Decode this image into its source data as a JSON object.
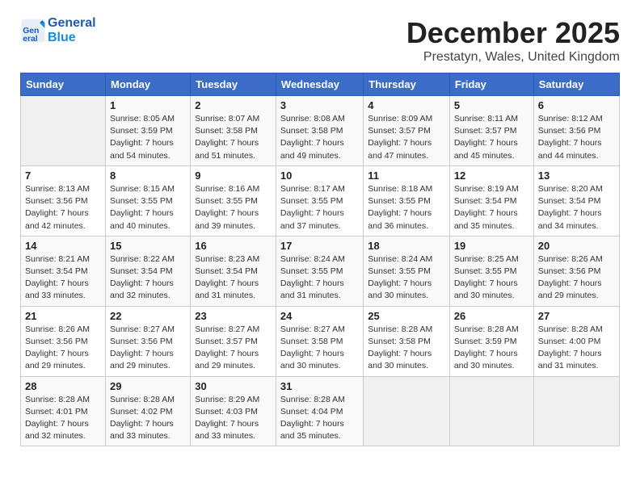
{
  "header": {
    "logo_line1": "General",
    "logo_line2": "Blue",
    "month": "December 2025",
    "location": "Prestatyn, Wales, United Kingdom"
  },
  "calendar": {
    "days_of_week": [
      "Sunday",
      "Monday",
      "Tuesday",
      "Wednesday",
      "Thursday",
      "Friday",
      "Saturday"
    ],
    "weeks": [
      [
        {
          "day": "",
          "info": ""
        },
        {
          "day": "1",
          "info": "Sunrise: 8:05 AM\nSunset: 3:59 PM\nDaylight: 7 hours\nand 54 minutes."
        },
        {
          "day": "2",
          "info": "Sunrise: 8:07 AM\nSunset: 3:58 PM\nDaylight: 7 hours\nand 51 minutes."
        },
        {
          "day": "3",
          "info": "Sunrise: 8:08 AM\nSunset: 3:58 PM\nDaylight: 7 hours\nand 49 minutes."
        },
        {
          "day": "4",
          "info": "Sunrise: 8:09 AM\nSunset: 3:57 PM\nDaylight: 7 hours\nand 47 minutes."
        },
        {
          "day": "5",
          "info": "Sunrise: 8:11 AM\nSunset: 3:57 PM\nDaylight: 7 hours\nand 45 minutes."
        },
        {
          "day": "6",
          "info": "Sunrise: 8:12 AM\nSunset: 3:56 PM\nDaylight: 7 hours\nand 44 minutes."
        }
      ],
      [
        {
          "day": "7",
          "info": "Sunrise: 8:13 AM\nSunset: 3:56 PM\nDaylight: 7 hours\nand 42 minutes."
        },
        {
          "day": "8",
          "info": "Sunrise: 8:15 AM\nSunset: 3:55 PM\nDaylight: 7 hours\nand 40 minutes."
        },
        {
          "day": "9",
          "info": "Sunrise: 8:16 AM\nSunset: 3:55 PM\nDaylight: 7 hours\nand 39 minutes."
        },
        {
          "day": "10",
          "info": "Sunrise: 8:17 AM\nSunset: 3:55 PM\nDaylight: 7 hours\nand 37 minutes."
        },
        {
          "day": "11",
          "info": "Sunrise: 8:18 AM\nSunset: 3:55 PM\nDaylight: 7 hours\nand 36 minutes."
        },
        {
          "day": "12",
          "info": "Sunrise: 8:19 AM\nSunset: 3:54 PM\nDaylight: 7 hours\nand 35 minutes."
        },
        {
          "day": "13",
          "info": "Sunrise: 8:20 AM\nSunset: 3:54 PM\nDaylight: 7 hours\nand 34 minutes."
        }
      ],
      [
        {
          "day": "14",
          "info": "Sunrise: 8:21 AM\nSunset: 3:54 PM\nDaylight: 7 hours\nand 33 minutes."
        },
        {
          "day": "15",
          "info": "Sunrise: 8:22 AM\nSunset: 3:54 PM\nDaylight: 7 hours\nand 32 minutes."
        },
        {
          "day": "16",
          "info": "Sunrise: 8:23 AM\nSunset: 3:54 PM\nDaylight: 7 hours\nand 31 minutes."
        },
        {
          "day": "17",
          "info": "Sunrise: 8:24 AM\nSunset: 3:55 PM\nDaylight: 7 hours\nand 31 minutes."
        },
        {
          "day": "18",
          "info": "Sunrise: 8:24 AM\nSunset: 3:55 PM\nDaylight: 7 hours\nand 30 minutes."
        },
        {
          "day": "19",
          "info": "Sunrise: 8:25 AM\nSunset: 3:55 PM\nDaylight: 7 hours\nand 30 minutes."
        },
        {
          "day": "20",
          "info": "Sunrise: 8:26 AM\nSunset: 3:56 PM\nDaylight: 7 hours\nand 29 minutes."
        }
      ],
      [
        {
          "day": "21",
          "info": "Sunrise: 8:26 AM\nSunset: 3:56 PM\nDaylight: 7 hours\nand 29 minutes."
        },
        {
          "day": "22",
          "info": "Sunrise: 8:27 AM\nSunset: 3:56 PM\nDaylight: 7 hours\nand 29 minutes."
        },
        {
          "day": "23",
          "info": "Sunrise: 8:27 AM\nSunset: 3:57 PM\nDaylight: 7 hours\nand 29 minutes."
        },
        {
          "day": "24",
          "info": "Sunrise: 8:27 AM\nSunset: 3:58 PM\nDaylight: 7 hours\nand 30 minutes."
        },
        {
          "day": "25",
          "info": "Sunrise: 8:28 AM\nSunset: 3:58 PM\nDaylight: 7 hours\nand 30 minutes."
        },
        {
          "day": "26",
          "info": "Sunrise: 8:28 AM\nSunset: 3:59 PM\nDaylight: 7 hours\nand 30 minutes."
        },
        {
          "day": "27",
          "info": "Sunrise: 8:28 AM\nSunset: 4:00 PM\nDaylight: 7 hours\nand 31 minutes."
        }
      ],
      [
        {
          "day": "28",
          "info": "Sunrise: 8:28 AM\nSunset: 4:01 PM\nDaylight: 7 hours\nand 32 minutes."
        },
        {
          "day": "29",
          "info": "Sunrise: 8:28 AM\nSunset: 4:02 PM\nDaylight: 7 hours\nand 33 minutes."
        },
        {
          "day": "30",
          "info": "Sunrise: 8:29 AM\nSunset: 4:03 PM\nDaylight: 7 hours\nand 33 minutes."
        },
        {
          "day": "31",
          "info": "Sunrise: 8:28 AM\nSunset: 4:04 PM\nDaylight: 7 hours\nand 35 minutes."
        },
        {
          "day": "",
          "info": ""
        },
        {
          "day": "",
          "info": ""
        },
        {
          "day": "",
          "info": ""
        }
      ]
    ]
  }
}
